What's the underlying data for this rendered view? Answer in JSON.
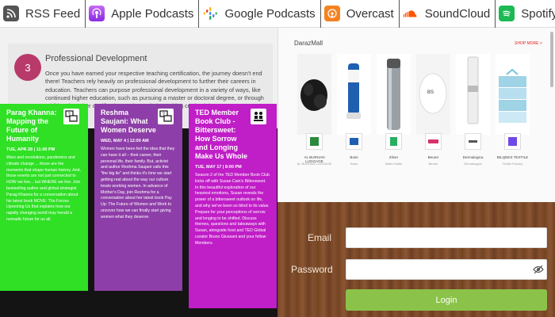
{
  "podcast_bar": {
    "items": [
      {
        "label": "RSS Feed",
        "icon": "rss-icon"
      },
      {
        "label": "Apple Podcasts",
        "icon": "apple-podcasts-icon"
      },
      {
        "label": "Google Podcasts",
        "icon": "google-podcasts-icon"
      },
      {
        "label": "Overcast",
        "icon": "overcast-icon"
      },
      {
        "label": "SoundCloud",
        "icon": "soundcloud-icon"
      },
      {
        "label": "Spotify",
        "icon": "spotify-icon"
      }
    ]
  },
  "professional_development": {
    "number": "3",
    "title": "Professional Development",
    "body": "Once you have earned your respective teaching certification, the journey doesn't end there! Teachers rely heavily on professional development to further their careers in education. Teachers can purpose professional development in a variety of ways, like continued higher education, such as pursuing a master or doctoral degree, or through additional teacher certifications to boost their teaching credentials."
  },
  "cards": [
    {
      "title": "Parag Khanna: Mapping the Future of Humanity",
      "date": "TUE, APR 28 | 11:00 PM",
      "text": "Wars and revolutions, pandemics and climate change ... those are the moments that shape human history. And, those events are not just connected to HOW we live... but WHERE we live. Join bestselling author and global strategist Parag Khanna for a conversation about his latest book MOVE: The Forces Uprooting Us that explains how our rapidly changing world may herald a nomadic future for us all.",
      "color": "#2fe025",
      "icon": "chat-question-icon"
    },
    {
      "title": "Reshma Saujani: What Women Deserve",
      "date": "WED, MAY 4 | 12:00 AM",
      "text": "Women have been fed the idea that they can have it all – their career, their personal life, their family. But, activist and author Reshma Saujani calls this \"the big lie\" and thinks it's time we start getting real about the way our culture treats working women. In advance of Mother's Day, join Reshma for a conversation about her latest book Pay Up: The Future of Women and Work to uncover how we can finally start giving women what they deserve.",
      "color": "#8e3ea8",
      "icon": "chat-question-icon"
    },
    {
      "title": "TED Member Book Club - Bittersweet: How Sorrow and Longing Make Us Whole",
      "date": "TUE, MAY 17 | 8:00 PM",
      "text": "Season 2 of the TED Member Book Club kicks off with Susan Cain's Bittersweet. In this beautiful exploration of our heaviest emotions, Susan reveals the power of a bittersweet outlook on life, and why we've been so blind to its value. Prepare for your perceptions of sorrow and longing to be shifted. Discuss themes, questions and takeaways with Susan, alongside host and TED Global curator Bruno Giussani and your fellow Members.",
      "color": "#c01ec7",
      "icon": "book-club-icon"
    }
  ],
  "shop": {
    "brand": "DarazMall",
    "more": "SHOP MORE >",
    "products": [
      {
        "name": "AL BURHAN LUGGAGE",
        "sub": "AL BURHAN LUGGAGE",
        "img": "black-backpack"
      },
      {
        "name": "Boss",
        "sub": "Boss",
        "img": "blue-appliance"
      },
      {
        "name": "Zilver",
        "sub": "Water Bottle",
        "img": "steel-bottle"
      },
      {
        "name": "Beurer",
        "sub": "Beurer",
        "img": "white-scale"
      },
      {
        "name": "Dermalogica",
        "sub": "Dermalogica",
        "img": "cream-tube"
      },
      {
        "name": "BILQEES TEXTILE",
        "sub": "Textile Factory",
        "img": "towel-stack"
      }
    ]
  },
  "login": {
    "email_label": "Email",
    "password_label": "Password",
    "email_value": "",
    "password_value": "",
    "button": "Login"
  }
}
